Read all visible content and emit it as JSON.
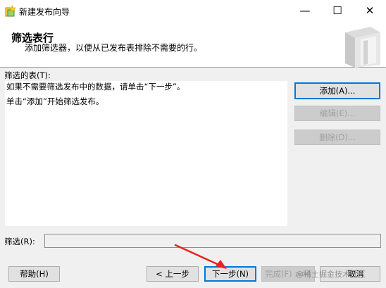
{
  "window": {
    "title": "新建发布向导",
    "minimize_glyph": "—",
    "maximize_glyph": "☐",
    "close_glyph": "✕"
  },
  "header": {
    "title": "筛选表行",
    "subtitle": "添加筛选器，以便从已发布表排除不需要的行。"
  },
  "filtered_tables": {
    "label": "筛选的表(T):",
    "lines": [
      "如果不需要筛选发布中的数据，请单击“下一步”。",
      "单击“添加”开始筛选发布。"
    ]
  },
  "side_buttons": {
    "add": "添加(A)...",
    "edit": "编辑(E)...",
    "delete": "删除(D)..."
  },
  "filter": {
    "label": "筛选(R):",
    "value": ""
  },
  "footer": {
    "help": "帮助(H)",
    "back": "< 上一步",
    "next": "下一步(N)",
    "finish": "完成(F) >>|",
    "cancel": "取消",
    "watermark": "@稀土掘金技术社区"
  },
  "colors": {
    "accent": "#0078d7",
    "annotation_arrow": "#e8231f",
    "window_bg": "#f0f0f0"
  }
}
